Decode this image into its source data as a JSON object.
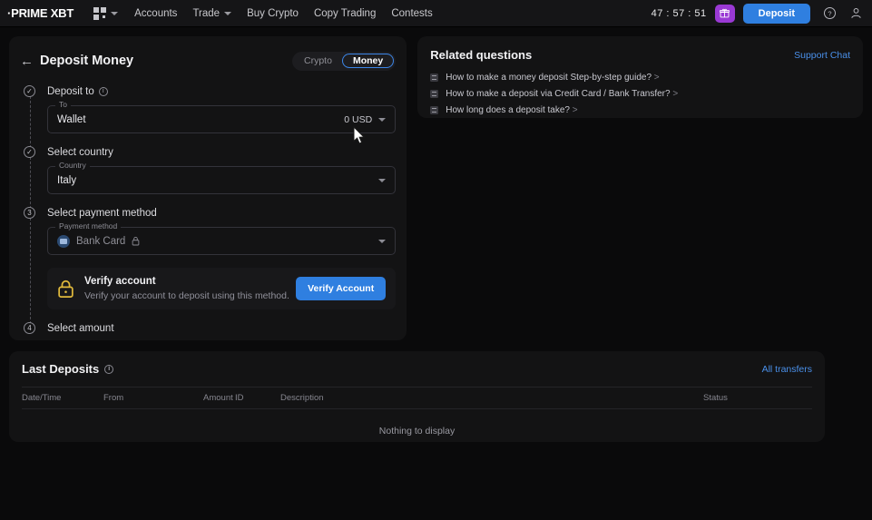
{
  "header": {
    "logo": "·PRIME XBT",
    "grid_icon": "apps-grid-icon",
    "nav": [
      {
        "label": "Accounts",
        "dropdown": false
      },
      {
        "label": "Trade",
        "dropdown": true
      },
      {
        "label": "Buy Crypto",
        "dropdown": false
      },
      {
        "label": "Copy Trading",
        "dropdown": false
      },
      {
        "label": "Contests",
        "dropdown": false
      }
    ],
    "timer": "47 : 57 : 51",
    "gift_icon": "gift-icon",
    "deposit_label": "Deposit",
    "help_icon": "question-mark-icon",
    "account_icon": "user-account-icon",
    "accent_blue": "#2f7fe0",
    "accent_purple": "#9a39d4"
  },
  "deposit": {
    "back_icon": "back-arrow-icon",
    "title": "Deposit Money",
    "toggle": {
      "options": [
        "Crypto",
        "Money"
      ],
      "selected": "Money"
    },
    "steps": [
      {
        "bullet": "✓",
        "state": "complete",
        "label": "Deposit to",
        "info_icon": "info-icon",
        "field": {
          "legend": "To",
          "value": "Wallet",
          "amount": "0 USD",
          "caret": "chevron-down-icon"
        }
      },
      {
        "bullet": "✓",
        "state": "complete",
        "label": "Select country",
        "field": {
          "legend": "Country",
          "value": "Italy",
          "caret": "chevron-down-icon"
        }
      },
      {
        "bullet": "3",
        "state": "active",
        "label": "Select payment method",
        "field": {
          "legend": "Payment method",
          "value": "Bank Card",
          "icon": "bank-card-icon",
          "lock": "lock-icon",
          "caret": "chevron-down-icon"
        }
      },
      {
        "bullet": "4",
        "state": "pending",
        "label": "Select amount"
      }
    ],
    "verify": {
      "icon": "padlock-icon",
      "icon_color": "#e0b93c",
      "title": "Verify account",
      "subtitle": "Verify your account to deposit using this method.",
      "button": "Verify Account"
    }
  },
  "related": {
    "title": "Related questions",
    "support_link": "Support Chat",
    "questions": [
      {
        "icon": "article-icon",
        "text": "How to make a money deposit Step-by-step guide?",
        "arrow": ">"
      },
      {
        "icon": "article-icon",
        "text": "How to make a deposit via Credit Card / Bank Transfer?",
        "arrow": ">"
      },
      {
        "icon": "article-icon",
        "text": "How long does a deposit take?",
        "arrow": ">"
      }
    ]
  },
  "last_deposits": {
    "title": "Last Deposits",
    "info_icon": "info-icon",
    "all_transfers": "All transfers",
    "columns": [
      "Date/Time",
      "From",
      "Amount",
      "ID",
      "Description",
      "Status"
    ],
    "rows": [],
    "empty_text": "Nothing to display"
  },
  "cursor": {
    "icon": "mouse-pointer-icon"
  }
}
